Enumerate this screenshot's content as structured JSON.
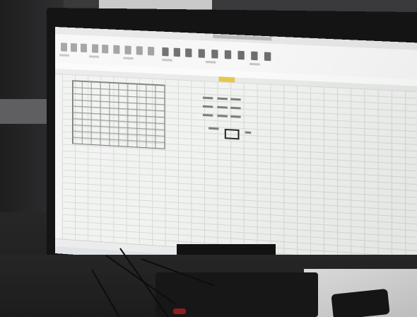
{
  "scene": {
    "subject": "monitor-showing-spreadsheet",
    "colors": {
      "screen": "#f1f3f1",
      "bezel": "#141414",
      "highlight_column": "#e8c64a",
      "desk": "#1c1c1d"
    }
  },
  "icons": [
    "spreadsheet-app-icon",
    "taskbar-start-icon",
    "taskbar-search-icon",
    "taskbar-file-explorer-icon",
    "taskbar-browser-icon"
  ]
}
